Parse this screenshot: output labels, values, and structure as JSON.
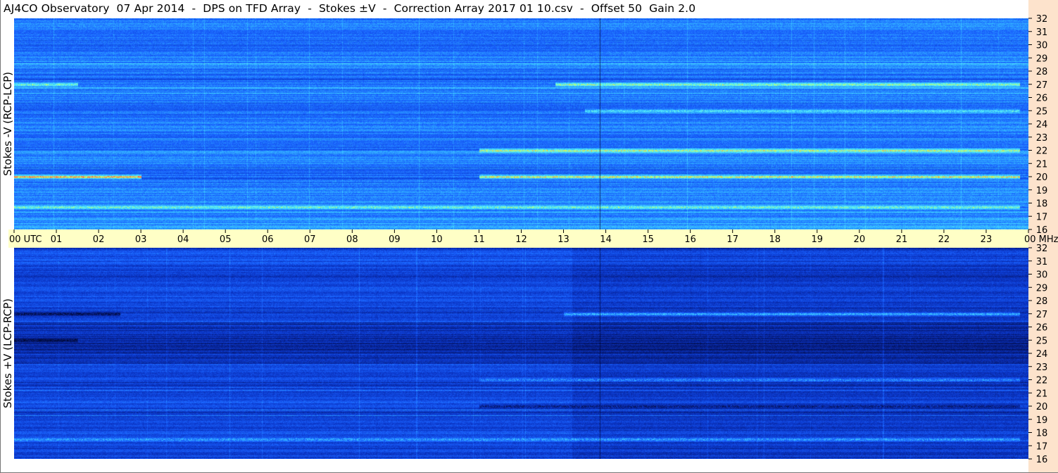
{
  "title": "AJ4CO Observatory  07 Apr 2014  -  DPS on TFD Array  -  Stokes ±V  -  Correction Array 2017 01 10.csv  -  Offset 50  Gain 2.0",
  "chart_data": [
    {
      "type": "heatmap",
      "panel": "top",
      "ylabel": "Stokes -V (RCP-LCP)",
      "x_ticks": [
        "00 UTC",
        "01",
        "02",
        "03",
        "04",
        "05",
        "06",
        "07",
        "08",
        "09",
        "10",
        "11",
        "12",
        "13",
        "14",
        "15",
        "16",
        "17",
        "18",
        "19",
        "20",
        "21",
        "22",
        "23",
        "00 MHz"
      ],
      "y_ticks": [
        "32",
        "31",
        "30",
        "29",
        "28",
        "27",
        "26",
        "25",
        "24",
        "23",
        "22",
        "21",
        "20",
        "19",
        "18",
        "17",
        "16"
      ],
      "xlim": [
        0,
        24
      ],
      "ylim": [
        16,
        32
      ],
      "x_units": "UTC hour",
      "y_units": "MHz",
      "colormap": [
        "#0a1e80",
        "#0b3fd0",
        "#1a63ff",
        "#33b7ff",
        "#55f0ff",
        "#c8ff60",
        "#ff5050"
      ],
      "features": [
        {
          "freq": 27.0,
          "time": [
            0,
            1.5
          ],
          "intensity": 0.7
        },
        {
          "freq": 27.0,
          "time": [
            12.8,
            23.8
          ],
          "intensity": 0.75
        },
        {
          "freq": 25.0,
          "time": [
            13.5,
            23.8
          ],
          "intensity": 0.6
        },
        {
          "freq": 22.0,
          "time": [
            11.0,
            23.8
          ],
          "intensity": 0.8
        },
        {
          "freq": 20.0,
          "time": [
            0,
            3.0
          ],
          "intensity": 0.95
        },
        {
          "freq": 20.0,
          "time": [
            11.0,
            23.8
          ],
          "intensity": 0.85
        },
        {
          "freq": 17.7,
          "time": [
            0,
            23.8
          ],
          "intensity": 0.7
        }
      ]
    },
    {
      "type": "heatmap",
      "panel": "bottom",
      "ylabel": "Stokes +V (LCP-RCP)",
      "x_ticks": [
        "00 UTC",
        "01",
        "02",
        "03",
        "04",
        "05",
        "06",
        "07",
        "08",
        "09",
        "10",
        "11",
        "12",
        "13",
        "14",
        "15",
        "16",
        "17",
        "18",
        "19",
        "20",
        "21",
        "22",
        "23",
        "00 MHz"
      ],
      "y_ticks": [
        "32",
        "31",
        "30",
        "29",
        "28",
        "27",
        "26",
        "25",
        "24",
        "23",
        "22",
        "21",
        "20",
        "19",
        "18",
        "17",
        "16"
      ],
      "xlim": [
        0,
        24
      ],
      "ylim": [
        16,
        32
      ],
      "x_units": "UTC hour",
      "y_units": "MHz",
      "colormap": [
        "#000830",
        "#061a78",
        "#0b36c8",
        "#1a63ff",
        "#33b7ff",
        "#55f0ff",
        "#c8ff60"
      ],
      "features": [
        {
          "freq": 27.0,
          "time": [
            0,
            2.5
          ],
          "intensity": 0.1
        },
        {
          "freq": 27.0,
          "time": [
            13.0,
            23.8
          ],
          "intensity": 0.65
        },
        {
          "freq": 25.0,
          "time": [
            0,
            1.5
          ],
          "intensity": 0.05
        },
        {
          "freq": 22.0,
          "time": [
            11.0,
            23.8
          ],
          "intensity": 0.55
        },
        {
          "freq": 20.0,
          "time": [
            11.0,
            23.8
          ],
          "intensity": 0.2
        },
        {
          "freq": 17.5,
          "time": [
            0,
            23.8
          ],
          "intensity": 0.6
        }
      ]
    }
  ]
}
